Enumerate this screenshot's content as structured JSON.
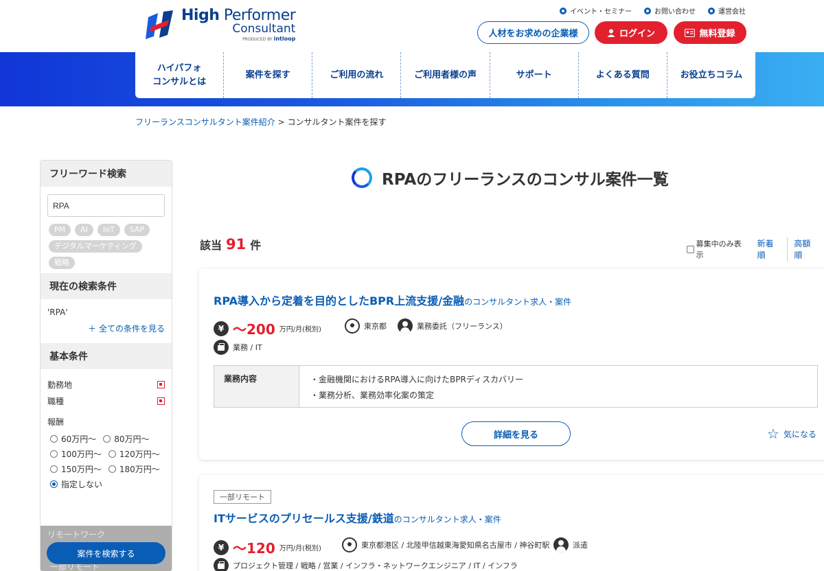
{
  "header": {
    "logo": {
      "line1_bold": "High",
      "line1_rest": " Performer",
      "line2": "Consultant",
      "line3_prefix": "PRODUCED BY",
      "line3_brand": "intloop"
    },
    "util_links": [
      "イベント・セミナー",
      "お問い合わせ",
      "運営会社"
    ],
    "buttons": {
      "corporate": "人材をお求めの企業様",
      "login": "ログイン",
      "register": "無料登録"
    },
    "nav": [
      "ハイパフォ\nコンサルとは",
      "案件を探す",
      "ご利用の流れ",
      "ご利用者様の声",
      "サポート",
      "よくある質問",
      "お役立ちコラム"
    ],
    "colors": {
      "brand_blue": "#0a5db5",
      "brand_red": "#e3202e"
    }
  },
  "breadcrumb": {
    "home": "フリーランスコンサルタント案件紹介",
    "sep": ">",
    "current": "コンサルタント案件を探す"
  },
  "sidebar": {
    "freeword_title": "フリーワード検索",
    "freeword_value": "RPA",
    "tags": [
      "PM",
      "AI",
      "IoT",
      "SAP",
      "デジタルマーケティング",
      "戦略"
    ],
    "current_title": "現在の検索条件",
    "current_value": "'RPA'",
    "see_all": "＋ 全ての条件を見る",
    "basic_title": "基本条件",
    "conditions": [
      "勤務地",
      "職種"
    ],
    "reward_label": "報酬",
    "reward_options": [
      "60万円〜",
      "80万円〜",
      "100万円〜",
      "120万円〜",
      "150万円〜",
      "180万円〜",
      "指定しない"
    ],
    "reward_selected": "指定しない",
    "remote_label": "リモートワーク",
    "partial_label": "一部リモート",
    "search_button": "案件を検索する"
  },
  "main": {
    "title": "RPAのフリーランスのコンサル案件一覧",
    "count_prefix": "該当",
    "count": "91",
    "count_suffix": "件",
    "filter_label": "募集中のみ表示",
    "sort_new": "新着順",
    "sort_high": "高額順"
  },
  "jobs": [
    {
      "title": "RPA導入から定着を目的としたBPR上流支援/金融",
      "suffix": "のコンサルタント求人・案件",
      "yen": "¥",
      "price": "〜200",
      "price_unit": "万円/月(税別)",
      "location": "東京都",
      "contract": "業務委託（フリーランス）",
      "category": "業務 / IT",
      "table_head": "業務内容",
      "duties": [
        "・金融機関におけるRPA導入に向けたBPRディスカバリー",
        "・業務分析、業務効率化案の策定"
      ],
      "detail_button": "詳細を見る",
      "favorite": "気になる"
    },
    {
      "badge": "一部リモート",
      "title": "ITサービスのプリセールス支援/鉄道",
      "suffix": "のコンサルタント求人・案件",
      "yen": "¥",
      "price": "〜120",
      "price_unit": "万円/月(税別)",
      "location": "東京都港区 / 北陸甲信越東海愛知県名古屋市 / 神谷町駅",
      "contract": "派遣",
      "category": "プロジェクト管理 / 戦略 / 営業 / インフラ・ネットワークエンジニア / IT / インフラ"
    }
  ]
}
